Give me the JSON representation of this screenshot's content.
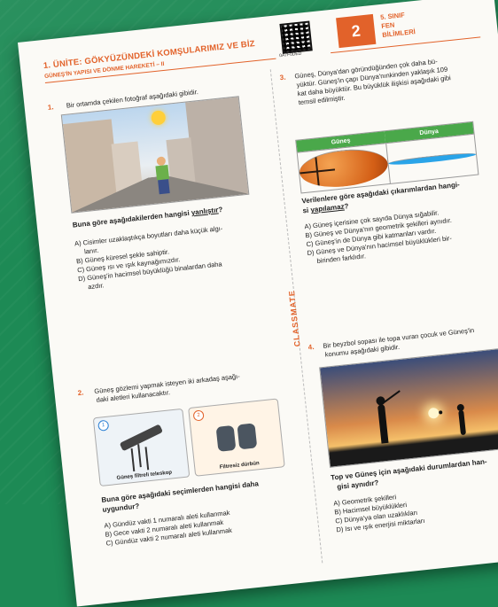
{
  "header": {
    "unit": "1. ÜNİTE: GÖKYÜZÜNDEKİ KOMŞULARIMIZ VE BİZ",
    "subtitle": "GÜNEŞ'İN YAPISI VE DÖNME HAREKETİ – II",
    "qr_code": "0A7F0DED",
    "page_number": "2",
    "grade": [
      "5. SINIF",
      "FEN",
      "BİLİMLERİ"
    ]
  },
  "watermark": "CLASSMATE",
  "q1": {
    "num": "1.",
    "text": "Bir ortamda çekilen fotoğraf aşağıdaki gibidir.",
    "question_pre": "Buna göre aşağıdakilerden hangisi ",
    "question_u": "yanlıştır",
    "question_post": "?",
    "options": [
      "A) Cisimler uzaklaştıkça boyutları daha küçük algı-",
      "lanır.",
      "B) Güneş küresel şekle sahiptir.",
      "C) Güneş ısı ve ışık kaynağımızdır.",
      "D) Güneş'in hacimsel büyüklüğü binalardan daha",
      "azdır."
    ]
  },
  "q2": {
    "num": "2.",
    "text": [
      "Güneş gözlemi yapmak isteyen iki arkadaş aşağı-",
      "daki aletleri kullanacaktır."
    ],
    "images": [
      {
        "num": "1",
        "caption": "Güneş filtreli teleskop"
      },
      {
        "num": "2",
        "caption": "Filtresiz dürbün"
      }
    ],
    "question": [
      "Buna göre aşağıdaki seçimlerden hangisi daha",
      "uygundur?"
    ],
    "options": [
      "A) Gündüz vakti 1 numaralı aleti kullanmak",
      "B) Gece vakti 2 numaralı aleti kullanmak",
      "C) Gündüz vakti 2 numaralı aleti kullanmak"
    ]
  },
  "q3": {
    "num": "3.",
    "text": [
      "Güneş, Dünya'dan göründüğünden çok daha bü-",
      "yüktür. Güneş'in çapı Dünya'nınkinden yaklaşık 109",
      "kat daha büyüktür. Bu büyüklük ilişkisi aşağıdaki gibi",
      "temsil edilmiştir."
    ],
    "table_headers": [
      "Güneş",
      "Dünya"
    ],
    "question_line1": "Verilenlere göre aşağıdaki çıkarımlardan hangi-",
    "question_pre": "si ",
    "question_u": "yapılamaz",
    "question_post": "?",
    "options": [
      "A) Güneş içerisine çok sayıda Dünya sığabilir.",
      "B) Güneş ve Dünya'nın geometrik şekilleri aynıdır.",
      "C) Güneş'in de Dünya gibi katmanları vardır.",
      "D) Güneş ve Dünya'nın hacimsel büyüklükleri bir-",
      "birinden farklıdır."
    ]
  },
  "q4": {
    "num": "4.",
    "text": [
      "Bir beyzbol sopası ile topa vuran çocuk ve Güneş'in",
      "konumu aşağıdaki gibidir."
    ],
    "question": [
      "Top ve Güneş için aşağıdaki durumlardan han-",
      "gisi aynıdır?"
    ],
    "options": [
      "A) Geometrik şekilleri",
      "B) Hacimsel büyüklükleri",
      "C) Dünya'ya olan uzaklıkları",
      "D) Isı ve ışık enerjisi miktarları"
    ]
  }
}
